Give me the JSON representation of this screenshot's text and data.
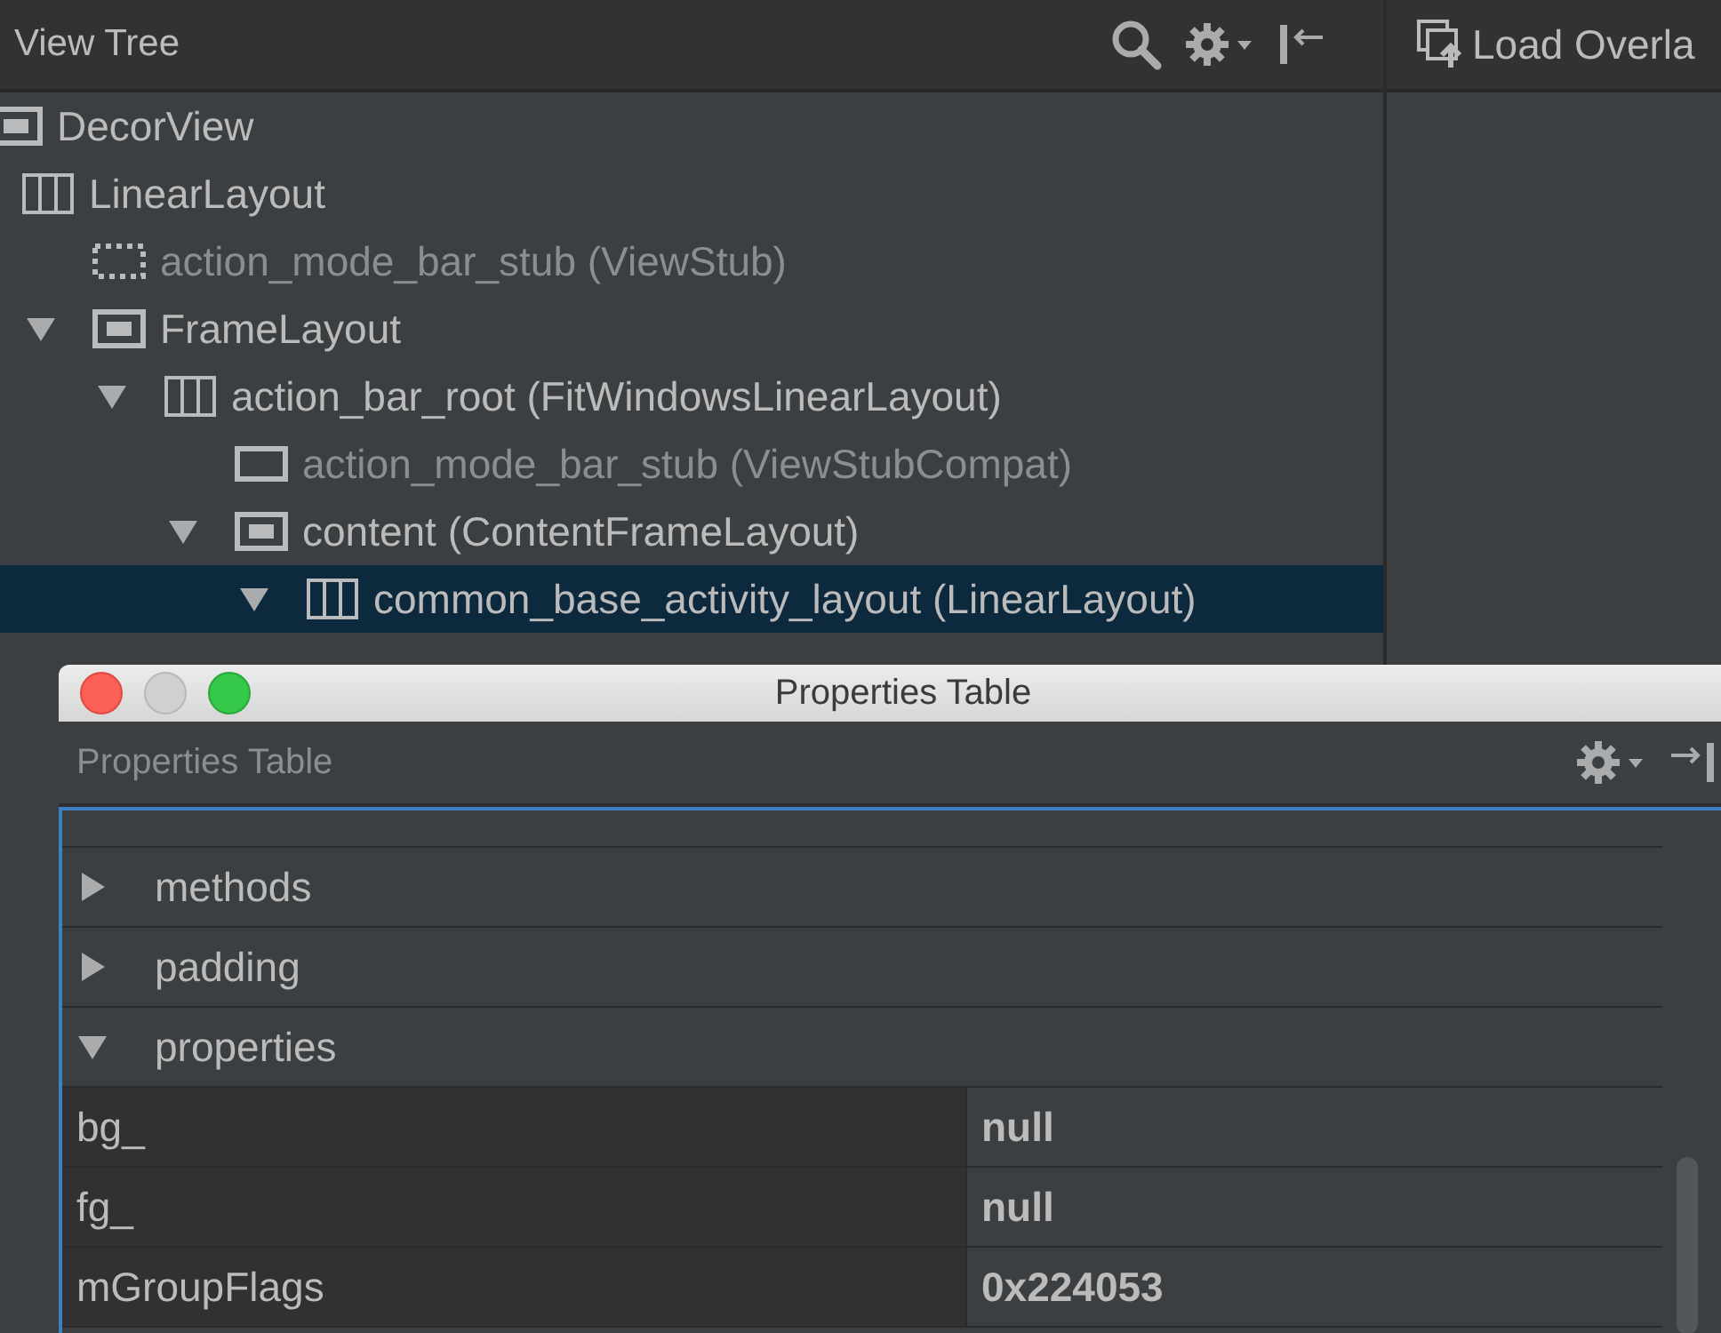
{
  "view_tree": {
    "title": "View Tree",
    "nodes": [
      {
        "label": "DecorView",
        "kind": "frame",
        "dimmed": false,
        "selected": false,
        "children": [
          {
            "label": "LinearLayout",
            "kind": "linear",
            "dimmed": false,
            "selected": false,
            "children": [
              {
                "label": "action_mode_bar_stub (ViewStub)",
                "kind": "stub",
                "dimmed": true,
                "selected": false
              },
              {
                "label": "FrameLayout",
                "kind": "frame",
                "dimmed": false,
                "selected": false,
                "expanded": true,
                "children": [
                  {
                    "label": "action_bar_root (FitWindowsLinearLayout)",
                    "kind": "linear",
                    "dimmed": false,
                    "selected": false,
                    "expanded": true,
                    "children": [
                      {
                        "label": "action_mode_bar_stub (ViewStubCompat)",
                        "kind": "plain",
                        "dimmed": true,
                        "selected": false
                      },
                      {
                        "label": "content (ContentFrameLayout)",
                        "kind": "frame",
                        "dimmed": false,
                        "selected": false,
                        "expanded": true,
                        "children": [
                          {
                            "label": "common_base_activity_layout (LinearLayout)",
                            "kind": "linear",
                            "dimmed": false,
                            "selected": true,
                            "expanded": true
                          }
                        ]
                      }
                    ]
                  }
                ]
              }
            ]
          }
        ]
      }
    ]
  },
  "overlay_button": {
    "label": "Load Overla"
  },
  "properties_window": {
    "title": "Properties Table",
    "header": "Properties Table",
    "rows": [
      {
        "kind": "group",
        "name": "methods",
        "expanded": false
      },
      {
        "kind": "group",
        "name": "padding",
        "expanded": false
      },
      {
        "kind": "group",
        "name": "properties",
        "expanded": true
      },
      {
        "kind": "property",
        "name": "bg_",
        "value": "null"
      },
      {
        "kind": "property",
        "name": "fg_",
        "value": "null"
      },
      {
        "kind": "property",
        "name": "mGroupFlags",
        "value": "0x224053"
      }
    ]
  }
}
